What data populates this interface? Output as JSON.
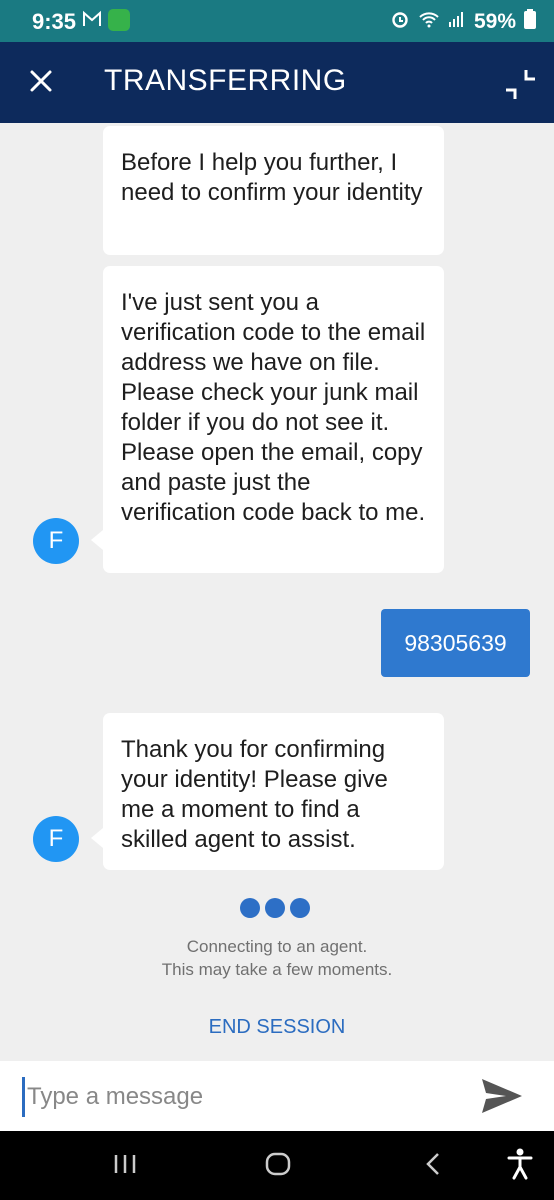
{
  "status_bar": {
    "time": "9:35",
    "battery": "59%"
  },
  "header": {
    "title": "TRANSFERRING",
    "background": "#0d2a5c"
  },
  "messages": {
    "agent_1": "Before I help you further, I need to confirm your identity",
    "agent_2": "I've just sent you a verification code to the email address we have on file. Please check your junk mail folder if you do not see it. Please open the email, copy and paste just the verification code back to me.",
    "user_1": "98305639",
    "agent_3": "Thank you for confirming your identity! Please give me a moment to find a skilled agent to assist.",
    "avatar_initial": "F"
  },
  "connecting": {
    "line1": "Connecting to an agent.",
    "line2": "This may take a few moments."
  },
  "end_session_label": "END SESSION",
  "composer": {
    "placeholder": "Type a message"
  },
  "colors": {
    "accent": "#2f79cf",
    "avatar": "#2196f3",
    "status_bar": "#1a7a82"
  },
  "icons": [
    "close-icon",
    "minimize-icon",
    "send-icon",
    "recent-apps-icon",
    "home-icon",
    "back-icon",
    "accessibility-icon",
    "alarm-icon",
    "wifi-icon",
    "signal-icon",
    "battery-icon",
    "gmail-icon"
  ]
}
